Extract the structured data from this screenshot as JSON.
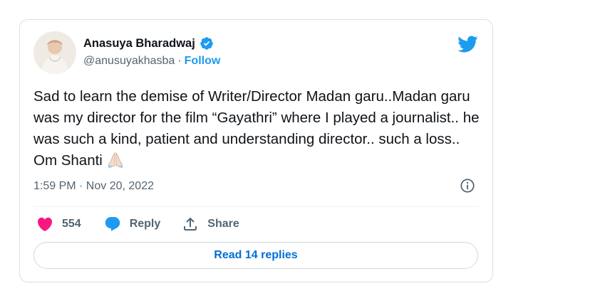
{
  "tweet": {
    "author": {
      "name": "Anasuya Bharadwaj",
      "handle": "@anusuyakhasba",
      "separator": "·",
      "follow_label": "Follow",
      "verified": true
    },
    "text": "Sad to learn the demise of Writer/Director Madan garu..Madan garu was my director for the film “Gayathri” where I played a journalist.. he was such a kind, patient and understanding director.. such a loss.. Om Shanti",
    "emoji": "folded-hands",
    "timestamp": "1:59 PM · Nov 20, 2022",
    "likes": "554",
    "reply_label": "Reply",
    "share_label": "Share",
    "read_replies_label": "Read 14 replies"
  },
  "colors": {
    "accent": "#1d9bf0",
    "like": "#f91880",
    "muted": "#536471",
    "text": "#0f1419",
    "border": "#d9dfe3",
    "read_replies": "#006fd6"
  },
  "icons": {
    "brand": "twitter-bird-icon",
    "verified": "verified-badge-icon",
    "info": "info-icon",
    "like": "heart-icon",
    "reply": "speech-bubble-icon",
    "share": "share-upload-icon"
  }
}
